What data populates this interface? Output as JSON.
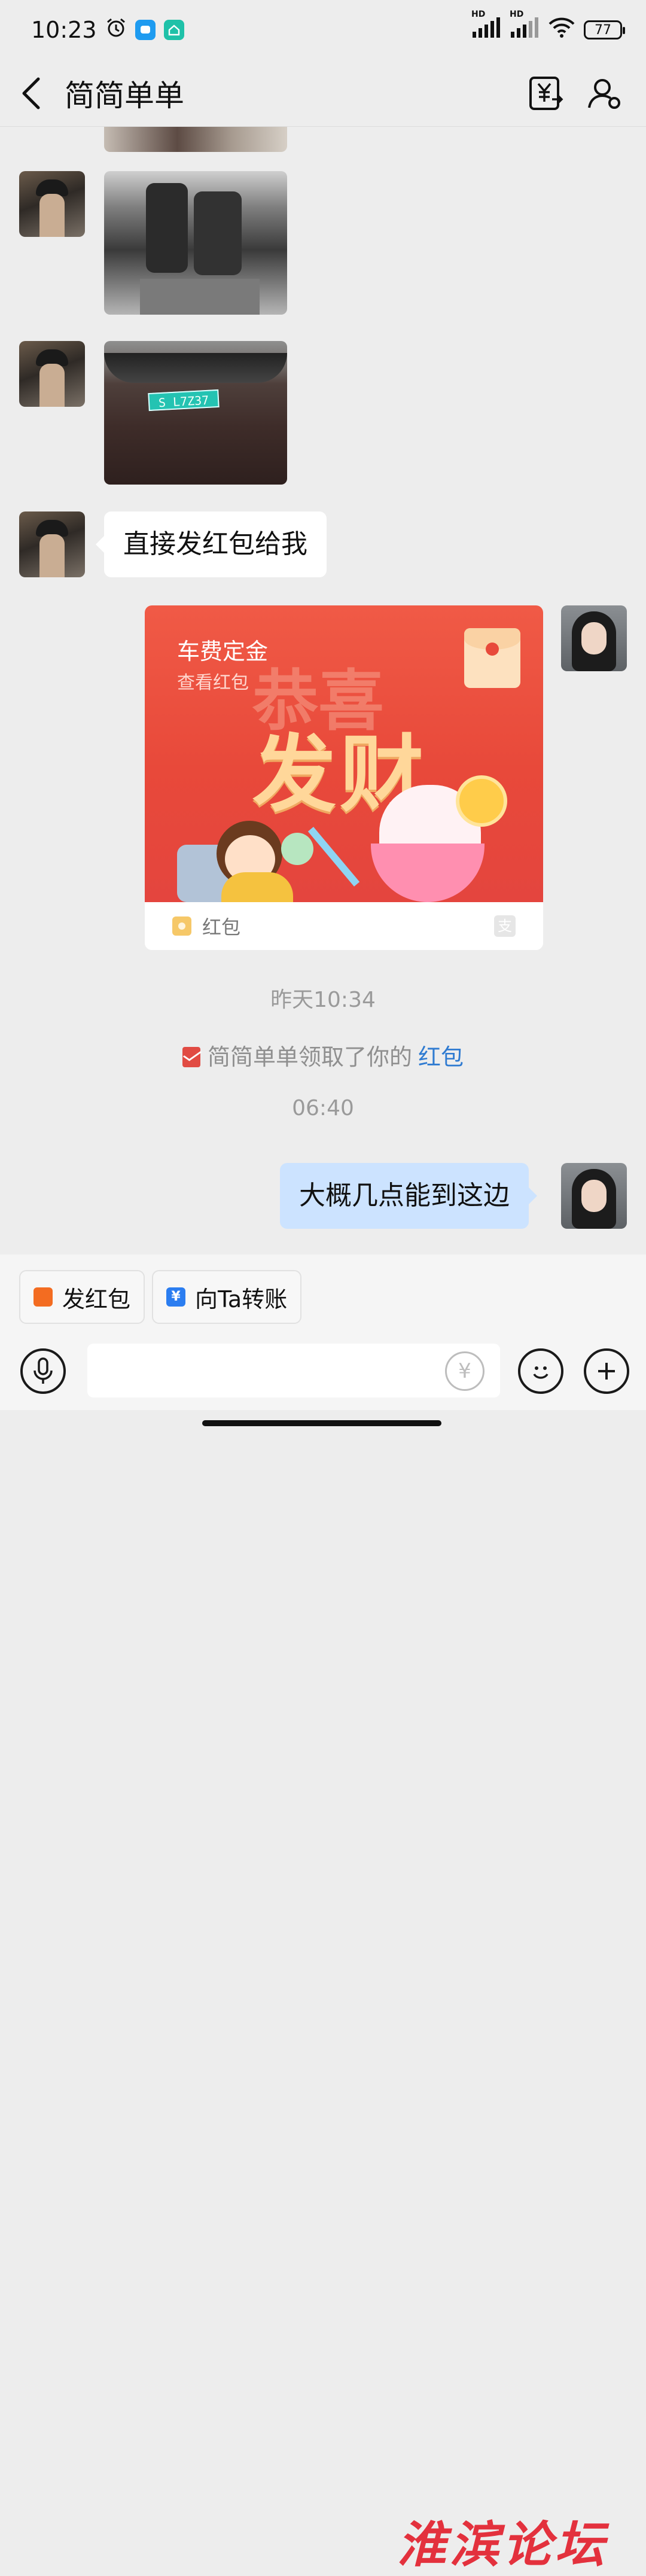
{
  "status_bar": {
    "time": "10:23",
    "signal1_label": "HD",
    "signal2_label": "HD",
    "battery": "77"
  },
  "header": {
    "back_icon": "chevron-left-icon",
    "title": "简简单单",
    "transfer_icon": "yuan-transfer-icon",
    "profile_icon": "user-settings-icon"
  },
  "messages": {
    "plate_text": "S L7Z37",
    "text_msg_1": "直接发红包给我",
    "red_packet": {
      "title": "车费定金",
      "subtitle": "查看红包",
      "art_text": "发财",
      "art_ghost": "恭喜",
      "footer_label": "红包",
      "footer_brand_glyph": "支"
    },
    "time_1": "昨天10:34",
    "notice": {
      "text": "简简单单领取了你的",
      "link": "红包"
    },
    "time_2": "06:40",
    "text_msg_2": "大概几点能到这边"
  },
  "quick_actions": [
    {
      "label": "发红包",
      "icon_glyph": "",
      "color": "#f36c21"
    },
    {
      "label": "向Ta转账",
      "icon_glyph": "¥",
      "color": "#2b7df0"
    }
  ],
  "watermark": "淮滨论坛",
  "input": {
    "placeholder": "",
    "coin_glyph": "¥"
  },
  "colors": {
    "background": "#ededed",
    "outgoing_bubble": "#cce3ff",
    "incoming_bubble": "#ffffff",
    "red_packet": "#e8493a",
    "link": "#2f7bd1"
  }
}
